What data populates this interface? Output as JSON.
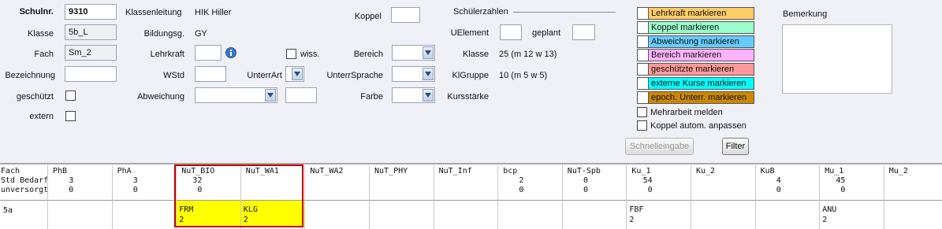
{
  "form": {
    "schulnr_label": "Schulnr.",
    "schulnr_value": "9310",
    "klasse_label": "Klasse",
    "klasse_value": "5b_L",
    "fach_label": "Fach",
    "fach_value": "Sm_2",
    "bezeichnung_label": "Bezeichnung",
    "bezeichnung_value": "",
    "geschuetzt_label": "geschützt",
    "extern_label": "extern",
    "klassenleitung_label": "Klassenleitung",
    "klassenleitung_value": "HIK Hiller",
    "bildungsg_label": "Bildungsg.",
    "bildungsg_value": "GY",
    "lehrkraft_label": "Lehrkraft",
    "lehrkraft_value": "",
    "wstd_label": "WStd",
    "wstd_value": "",
    "unterrart_label": "UnterrArt",
    "abweichung_label": "Abweichung",
    "wiss_label": "wiss.",
    "koppel_label": "Koppel",
    "koppel_value": "",
    "bereich_label": "Bereich",
    "unterrsprache_label": "UnterrSprache",
    "farbe_label": "Farbe"
  },
  "schuelerzahlen": {
    "title": "Schülerzahlen",
    "uelement_label": "UElement",
    "geplant_label": "geplant",
    "klasse_label": "Klasse",
    "klasse_value": "25 (m 12 w 13)",
    "klgruppe_label": "KlGruppe",
    "klgruppe_value": "10 (m 5 w 5)",
    "kursstaerke_label": "Kursstärke"
  },
  "markers": [
    {
      "label": "Lehrkraft markieren",
      "color": "#ffcc66"
    },
    {
      "label": "Koppel markieren",
      "color": "#99ffcc"
    },
    {
      "label": "Abweichung markieren",
      "color": "#66ccff"
    },
    {
      "label": "Bereich markieren",
      "color": "#ffb3ff"
    },
    {
      "label": "geschützte markieren",
      "color": "#ff9999"
    },
    {
      "label": "externe Kurse markieren",
      "color": "#00ffff"
    },
    {
      "label": "epoch. Unterr. markieren",
      "color": "#cc8800"
    }
  ],
  "options": {
    "mehrarbeit_label": "Mehrarbeit melden",
    "koppel_auto_label": "Koppel autom. anpassen"
  },
  "buttons": {
    "schnelleingabe": "Schnelleingabe",
    "filter": "Filter"
  },
  "bemerkung_label": "Bemerkung",
  "grid": {
    "row_labels": [
      "Fach",
      "Std Bedarf",
      "unversorgt"
    ],
    "columns": [
      {
        "fach": "PhB",
        "bedarf": "3",
        "unversorgt": "0",
        "cell": "",
        "cell_sub": "",
        "highlight": false
      },
      {
        "fach": "PhA",
        "bedarf": "3",
        "unversorgt": "0",
        "cell": "",
        "cell_sub": "",
        "highlight": false
      },
      {
        "fach": "NuT_BIO",
        "bedarf": "32",
        "unversorgt": "0",
        "cell": "FRM",
        "cell_sub": "2",
        "highlight": true
      },
      {
        "fach": "NuT_WA1",
        "bedarf": "",
        "unversorgt": "",
        "cell": "KLG",
        "cell_sub": "2",
        "highlight": true
      },
      {
        "fach": "NuT_WA2",
        "bedarf": "",
        "unversorgt": "",
        "cell": "",
        "cell_sub": "",
        "highlight": false
      },
      {
        "fach": "NuT_PHY",
        "bedarf": "",
        "unversorgt": "",
        "cell": "",
        "cell_sub": "",
        "highlight": false
      },
      {
        "fach": "NuT_Inf",
        "bedarf": "",
        "unversorgt": "",
        "cell": "",
        "cell_sub": "",
        "highlight": false
      },
      {
        "fach": "bcp",
        "bedarf": "2",
        "unversorgt": "0",
        "cell": "",
        "cell_sub": "",
        "highlight": false
      },
      {
        "fach": "NuT-Spb",
        "bedarf": "0",
        "unversorgt": "0",
        "cell": "",
        "cell_sub": "",
        "highlight": false
      },
      {
        "fach": "Ku_1",
        "bedarf": "54",
        "unversorgt": "0",
        "cell": "FBF",
        "cell_sub": "2",
        "highlight": false
      },
      {
        "fach": "Ku_2",
        "bedarf": "",
        "unversorgt": "",
        "cell": "",
        "cell_sub": "",
        "highlight": false
      },
      {
        "fach": "KuB",
        "bedarf": "4",
        "unversorgt": "0",
        "cell": "",
        "cell_sub": "",
        "highlight": false
      },
      {
        "fach": "Mu_1",
        "bedarf": "45",
        "unversorgt": "0",
        "cell": "ANU",
        "cell_sub": "2",
        "highlight": false
      },
      {
        "fach": "Mu_2",
        "bedarf": "",
        "unversorgt": "",
        "cell": "",
        "cell_sub": "",
        "highlight": false
      }
    ],
    "class_row_label": "5a",
    "highlight_color": "#ffff00",
    "selection_border_color": "#c00000"
  }
}
